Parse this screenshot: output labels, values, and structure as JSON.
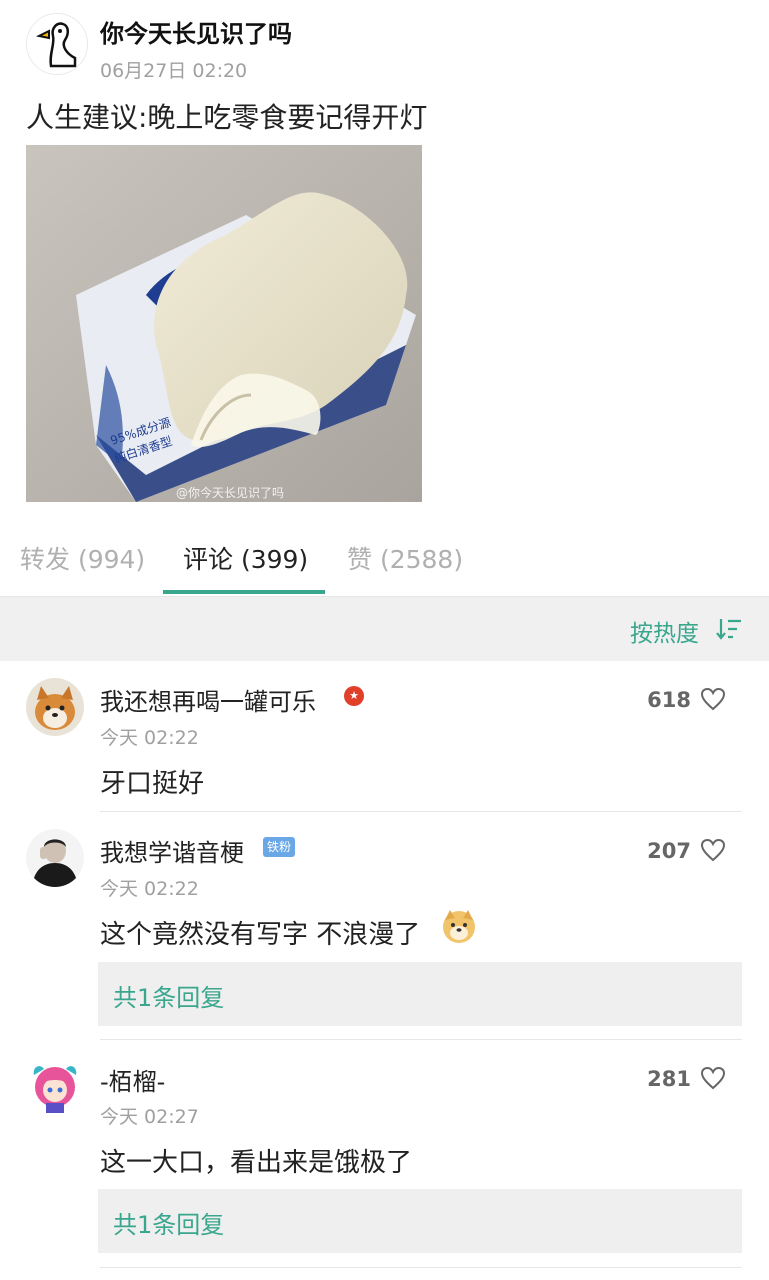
{
  "post": {
    "author": "你今天长见识了吗",
    "time": "06月27日 02:20",
    "text": "人生建议:晚上吃零食要记得开灯",
    "image_watermark": "@你今天长见识了吗",
    "image_box_text": "95%成分源 纯白清香型"
  },
  "tabs": {
    "repost": "转发 (994)",
    "comments": "评论 (399)",
    "likes": "赞 (2588)"
  },
  "sort": {
    "label": "按热度",
    "accent_color": "#3aa68e"
  },
  "comments": [
    {
      "name": "我还想再喝一罐可乐",
      "time": "今天 02:22",
      "text": "牙口挺好",
      "likes": "618",
      "badge": ""
    },
    {
      "name": "我想学谐音梗",
      "time": "今天 02:22",
      "text": "这个竟然没有写字 不浪漫了",
      "likes": "207",
      "badge": "铁粉",
      "reply": "共1条回复"
    },
    {
      "name": "-栢榴-",
      "time": "今天 02:27",
      "text": "这一大口，看出来是饿极了",
      "likes": "281",
      "reply": "共1条回复"
    }
  ]
}
